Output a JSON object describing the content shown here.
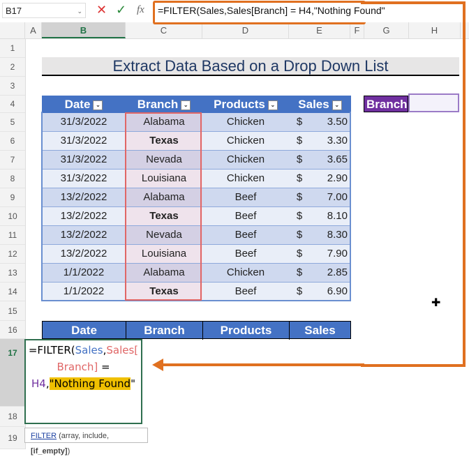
{
  "formula_bar": {
    "name_box": "B17",
    "cancel_icon": "✕",
    "enter_icon": "✓",
    "fx_icon": "fx",
    "formula": "=FILTER(Sales,Sales[Branch] = H4,\"Nothing Found\""
  },
  "columns": [
    "A",
    "B",
    "C",
    "D",
    "E",
    "F",
    "G",
    "H"
  ],
  "rows": [
    "1",
    "2",
    "3",
    "4",
    "5",
    "6",
    "7",
    "8",
    "9",
    "10",
    "11",
    "12",
    "13",
    "14",
    "15",
    "16",
    "17",
    "18",
    "19"
  ],
  "title": "Extract Data Based on a Drop Down List",
  "table": {
    "headers": [
      "Date",
      "Branch",
      "Products",
      "Sales"
    ],
    "rows": [
      {
        "date": "31/3/2022",
        "branch": "Alabama",
        "product": "Chicken",
        "currency": "$",
        "sales": "3.50"
      },
      {
        "date": "31/3/2022",
        "branch": "Texas",
        "product": "Chicken",
        "currency": "$",
        "sales": "3.30"
      },
      {
        "date": "31/3/2022",
        "branch": "Nevada",
        "product": "Chicken",
        "currency": "$",
        "sales": "3.65"
      },
      {
        "date": "31/3/2022",
        "branch": "Louisiana",
        "product": "Chicken",
        "currency": "$",
        "sales": "2.90"
      },
      {
        "date": "13/2/2022",
        "branch": "Alabama",
        "product": "Beef",
        "currency": "$",
        "sales": "7.00"
      },
      {
        "date": "13/2/2022",
        "branch": "Texas",
        "product": "Beef",
        "currency": "$",
        "sales": "8.10"
      },
      {
        "date": "13/2/2022",
        "branch": "Nevada",
        "product": "Beef",
        "currency": "$",
        "sales": "8.30"
      },
      {
        "date": "13/2/2022",
        "branch": "Louisiana",
        "product": "Beef",
        "currency": "$",
        "sales": "7.90"
      },
      {
        "date": "1/1/2022",
        "branch": "Alabama",
        "product": "Chicken",
        "currency": "$",
        "sales": "2.85"
      },
      {
        "date": "1/1/2022",
        "branch": "Texas",
        "product": "Beef",
        "currency": "$",
        "sales": "6.90"
      }
    ]
  },
  "branch_selector": {
    "label": "Branch",
    "value": ""
  },
  "output_table": {
    "headers": [
      "Date",
      "Branch",
      "Products",
      "Sales"
    ]
  },
  "editor": {
    "p1": "=FILTER(",
    "p2": "Sales",
    ",": ",",
    "p3": "Sales[",
    "p4": "Branch]",
    "p5": " = ",
    "p6": "H4",
    ",2": ",",
    "p7": "\"",
    "p8": "Nothing Found",
    "p9": "\""
  },
  "tooltip": {
    "fn": "FILTER",
    "args": " (array, include, ",
    "opt": "[if_empty]",
    ")": ")"
  },
  "colors": {
    "accent": "#4472c4",
    "highlight": "#e07020",
    "branch_label": "#7030a0"
  }
}
